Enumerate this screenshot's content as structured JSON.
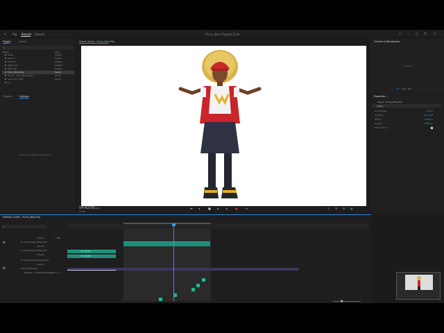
{
  "app": {
    "title": "Flurry_Boss Puppet_Final",
    "menu": [
      "Rig",
      "Record",
      "Stream"
    ],
    "active_menu": "Record"
  },
  "left_panel": {
    "tabs": [
      "Puppet",
      "Assets"
    ],
    "columns": {
      "name": "Name",
      "type": "Type"
    },
    "items": [
      {
        "name": "Jewel",
        "type": "Puppet"
      },
      {
        "name": "Jewel 2",
        "type": "Puppet"
      },
      {
        "name": "Left Arm",
        "type": "Puppet"
      },
      {
        "name": "Right Arm",
        "type": "Puppet"
      },
      {
        "name": "Jewel Kit",
        "type": "Puppet"
      },
      {
        "name": "Flurry_Boss Rig",
        "type": "Scene"
      },
      {
        "name": "Scene - Flurry_Boss Rig 2",
        "type": "Scene"
      },
      {
        "name": "Scene 03 (Idle)",
        "type": "Scene"
      },
      {
        "name": "Jo",
        "type": ""
      }
    ],
    "controls_tabs": [
      "Triggers",
      "Controls"
    ],
    "controls_placeholder": "Select a puppet to see controls"
  },
  "scene": {
    "header": "Scene: Scene - Flurry_Boss Rig",
    "timecode": "04:42:00",
    "fps": "24fps",
    "frame": "11 fps",
    "zoom": "Fit"
  },
  "camera": {
    "title": "Camera & Microphone",
    "status": "Paused",
    "buttons": [
      "Mic",
      "Cam",
      "Rec"
    ]
  },
  "properties": {
    "title": "Properties",
    "item": "Scene - Flurry_Boss Rig",
    "section": "Scene",
    "rows": [
      {
        "label": "Frame Rate",
        "value": "24 fps"
      },
      {
        "label": "Duration",
        "value": "09:15:08"
      },
      {
        "label": "Width",
        "value": "1920 px"
      },
      {
        "label": "Height",
        "value": "1080 px"
      },
      {
        "label": "Show Tracks",
        "value": ""
      }
    ]
  },
  "timeline": {
    "title": "Timeline: Scene - Flurry_Boss Rig",
    "search_placeholder": "",
    "tracks": [
      {
        "name": "Volume",
        "value": "0 dB"
      },
      {
        "name": "Sc_11_Mixdup_Body.mp3",
        "value": ""
      },
      {
        "name": "Volume",
        "value": "0 dB"
      },
      {
        "name": "Sc_12_Mixdup_Body.mp3",
        "value": ""
      },
      {
        "name": "Volume",
        "value": "0 dB"
      },
      {
        "name": "Sc_06_Mixdup_Body_Line3",
        "value": ""
      },
      {
        "name": "Volume",
        "value": "0 dB"
      },
      {
        "name": "Flurry_Boss Rig",
        "value": ""
      },
      {
        "name": "Dragger → Handle (Draggable L...)",
        "value": ""
      }
    ],
    "clip_labels": [
      "Sc_11_Mix..",
      "Sc_12_Mix.."
    ]
  },
  "colors": {
    "accent": "#2e88e0",
    "audio_clip": "#1c8f7a",
    "scene_bar": "#3b3660",
    "playhead": "#4a90e2"
  }
}
